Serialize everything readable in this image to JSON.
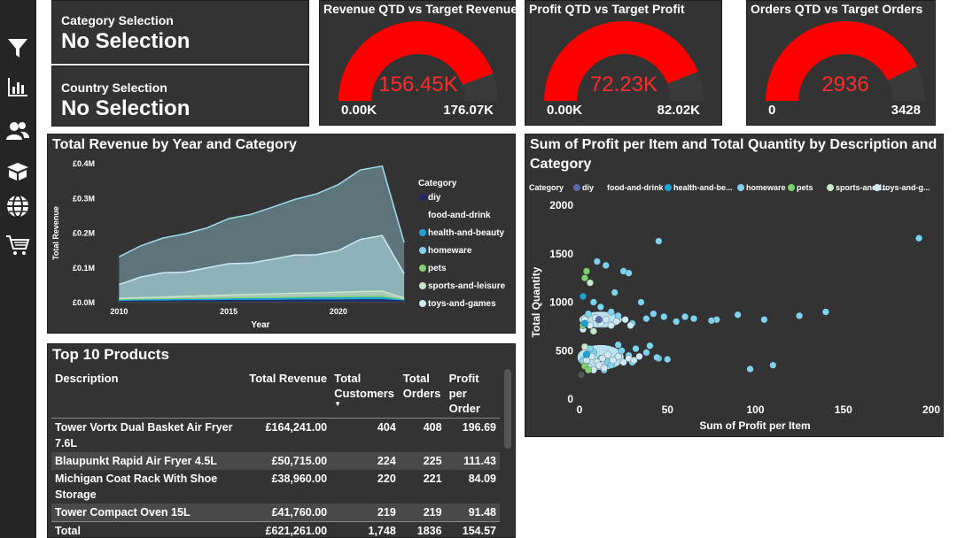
{
  "sidebar": {
    "icons": [
      "filter-icon",
      "bar-chart-icon",
      "users-icon",
      "box-icon",
      "globe-icon",
      "cart-icon"
    ]
  },
  "selections": {
    "category_label": "Category Selection",
    "category_value": "No Selection",
    "country_label": "Country Selection",
    "country_value": "No Selection"
  },
  "gauges": [
    {
      "title": "Revenue QTD vs Target Revenue",
      "value_label": "156.45K",
      "min_label": "0.00K",
      "max_label": "176.07K",
      "fraction": 0.888
    },
    {
      "title": "Profit QTD vs Target Profit",
      "value_label": "72.23K",
      "min_label": "0.00K",
      "max_label": "82.02K",
      "fraction": 0.88
    },
    {
      "title": "Orders QTD vs Target Orders",
      "value_label": "2936",
      "min_label": "0",
      "max_label": "3428",
      "fraction": 0.856
    }
  ],
  "colors": {
    "gauge_fill": "#ff0000",
    "gauge_value": "#ff2a2a",
    "panel_bg": "#333333",
    "diy": "#1c2a6b",
    "food-and-drink": "#333333",
    "health-and-beauty": "#1aa3d6",
    "homeware": "#7fd3ef",
    "pets": "#7ed36f",
    "sports-and-leisure": "#c8e6c9",
    "toys-and-games": "#cfeaf7"
  },
  "area_chart": {
    "title": "Total Revenue by Year and Category",
    "legend_title": "Category",
    "legend": [
      "diy",
      "food-and-drink",
      "health-and-beauty",
      "homeware",
      "pets",
      "sports-and-leisure",
      "toys-and-games"
    ],
    "y_ticks": [
      "£0.0M",
      "£0.1M",
      "£0.2M",
      "£0.3M",
      "£0.4M"
    ],
    "x_ticks": [
      "2010",
      "2015",
      "2020"
    ],
    "xlabel": "Year",
    "ylabel": "Total Revenue"
  },
  "scatter": {
    "title": "Sum of Profit per Item and Total Quantity by Description and Category",
    "legend_title": "Category",
    "legend": [
      "diy",
      "food-and-drink",
      "health-and-be...",
      "homeware",
      "pets",
      "sports-and-l...",
      "toys-and-g..."
    ],
    "y_ticks": [
      "0",
      "500",
      "1000",
      "1500",
      "2000"
    ],
    "x_ticks": [
      "0",
      "50",
      "100",
      "150",
      "200"
    ],
    "xlabel": "Sum of Profit per Item",
    "ylabel": "Total Quantity"
  },
  "chart_data": [
    {
      "type": "area",
      "title": "Total Revenue by Year and Category",
      "xlabel": "Year",
      "ylabel": "Total Revenue",
      "x": [
        2010,
        2011,
        2012,
        2013,
        2014,
        2015,
        2016,
        2017,
        2018,
        2019,
        2020,
        2021,
        2022,
        2023
      ],
      "ylim": [
        0,
        0.4
      ],
      "series": [
        {
          "name": "diy",
          "values": [
            0.002,
            0.003,
            0.003,
            0.004,
            0.004,
            0.005,
            0.005,
            0.005,
            0.006,
            0.006,
            0.006,
            0.007,
            0.007,
            0.003
          ]
        },
        {
          "name": "food-and-drink",
          "values": [
            0.001,
            0.001,
            0.001,
            0.001,
            0.001,
            0.001,
            0.001,
            0.001,
            0.001,
            0.001,
            0.001,
            0.001,
            0.001,
            0.001
          ]
        },
        {
          "name": "health-and-beauty",
          "values": [
            0.003,
            0.003,
            0.004,
            0.004,
            0.004,
            0.004,
            0.005,
            0.005,
            0.005,
            0.006,
            0.006,
            0.006,
            0.006,
            0.002
          ]
        },
        {
          "name": "homeware",
          "values": [
            0.08,
            0.09,
            0.1,
            0.11,
            0.115,
            0.13,
            0.14,
            0.15,
            0.16,
            0.175,
            0.19,
            0.2,
            0.2,
            0.09
          ]
        },
        {
          "name": "pets",
          "values": [
            0.002,
            0.002,
            0.002,
            0.002,
            0.003,
            0.003,
            0.003,
            0.003,
            0.003,
            0.003,
            0.004,
            0.004,
            0.004,
            0.002
          ]
        },
        {
          "name": "sports-and-leisure",
          "values": [
            0.004,
            0.005,
            0.006,
            0.007,
            0.008,
            0.009,
            0.01,
            0.011,
            0.012,
            0.012,
            0.013,
            0.014,
            0.015,
            0.005
          ]
        },
        {
          "name": "toys-and-games",
          "values": [
            0.04,
            0.06,
            0.07,
            0.07,
            0.08,
            0.09,
            0.09,
            0.1,
            0.11,
            0.11,
            0.12,
            0.15,
            0.16,
            0.07
          ]
        }
      ]
    },
    {
      "type": "scatter",
      "title": "Sum of Profit per Item and Total Quantity by Description and Category",
      "xlabel": "Sum of Profit per Item",
      "ylabel": "Total Quantity",
      "xlim": [
        0,
        200
      ],
      "ylim": [
        0,
        2000
      ],
      "series": [
        {
          "name": "homeware",
          "points": [
            [
              45,
              1630
            ],
            [
              193,
              1660
            ],
            [
              140,
              900
            ],
            [
              125,
              860
            ],
            [
              105,
              820
            ],
            [
              90,
              870
            ],
            [
              78,
              820
            ],
            [
              75,
              810
            ],
            [
              65,
              830
            ],
            [
              60,
              850
            ],
            [
              55,
              800
            ],
            [
              48,
              850
            ],
            [
              42,
              880
            ],
            [
              38,
              830
            ],
            [
              30,
              780
            ],
            [
              22,
              860
            ],
            [
              18,
              900
            ],
            [
              12,
              950
            ],
            [
              8,
              1000
            ],
            [
              5,
              880
            ],
            [
              25,
              1320
            ],
            [
              28,
              1300
            ],
            [
              15,
              1380
            ],
            [
              10,
              1420
            ],
            [
              20,
              1100
            ],
            [
              35,
              1000
            ],
            [
              110,
              350
            ],
            [
              97,
              310
            ],
            [
              50,
              410
            ],
            [
              45,
              420
            ],
            [
              38,
              480
            ],
            [
              32,
              520
            ],
            [
              28,
              450
            ],
            [
              22,
              560
            ],
            [
              16,
              380
            ],
            [
              12,
              420
            ],
            [
              8,
              480
            ],
            [
              6,
              520
            ],
            [
              4,
              350
            ],
            [
              2,
              400
            ],
            [
              14,
              300
            ],
            [
              18,
              350
            ],
            [
              24,
              500
            ],
            [
              30,
              380
            ],
            [
              40,
              550
            ],
            [
              44,
              430
            ]
          ]
        },
        {
          "name": "toys-and-games",
          "points": [
            [
              3,
              820
            ],
            [
              6,
              760
            ],
            [
              9,
              840
            ],
            [
              12,
              780
            ],
            [
              15,
              820
            ],
            [
              18,
              760
            ],
            [
              21,
              800
            ],
            [
              4,
              400
            ],
            [
              7,
              440
            ],
            [
              10,
              380
            ],
            [
              13,
              420
            ],
            [
              16,
              460
            ],
            [
              19,
              400
            ],
            [
              22,
              440
            ],
            [
              25,
              380
            ],
            [
              28,
              420
            ],
            [
              31,
              400
            ],
            [
              34,
              440
            ],
            [
              5,
              330
            ],
            [
              8,
              300
            ],
            [
              11,
              350
            ],
            [
              14,
              320
            ],
            [
              2,
              720
            ],
            [
              26,
              820
            ],
            [
              29,
              760
            ]
          ]
        },
        {
          "name": "pets",
          "points": [
            [
              4,
              1320
            ],
            [
              3,
              1250
            ],
            [
              2,
              760
            ],
            [
              3,
              340
            ],
            [
              5,
              300
            ]
          ]
        },
        {
          "name": "health-and-beauty",
          "points": [
            [
              2,
              1060
            ],
            [
              3,
              780
            ],
            [
              4,
              460
            ]
          ]
        },
        {
          "name": "sports-and-leisure",
          "points": [
            [
              6,
              1200
            ],
            [
              8,
              700
            ],
            [
              3,
              540
            ]
          ]
        },
        {
          "name": "diy",
          "points": [
            [
              11,
              820
            ]
          ]
        },
        {
          "name": "food-and-drink",
          "points": [
            [
              1,
              250
            ]
          ]
        }
      ]
    }
  ],
  "top10": {
    "title": "Top 10 Products",
    "headers": [
      "Description",
      "Total Revenue",
      "Total Customers",
      "Total Orders",
      "Profit per Order"
    ],
    "rows": [
      [
        "Tower Vortx Dual Basket Air Fryer 7.6L",
        "£164,241.00",
        "404",
        "408",
        "196.69"
      ],
      [
        "Blaupunkt Rapid Air Fryer 4.5L",
        "£50,715.00",
        "224",
        "225",
        "111.43"
      ],
      [
        "Michigan Coat Rack With Shoe Storage",
        "£38,960.00",
        "220",
        "221",
        "84.09"
      ],
      [
        "Tower Compact Oven 15L",
        "£41,760.00",
        "219",
        "219",
        "91.48"
      ]
    ],
    "total": [
      "Total",
      "£621,261.00",
      "1,748",
      "1836",
      "154.57"
    ]
  }
}
